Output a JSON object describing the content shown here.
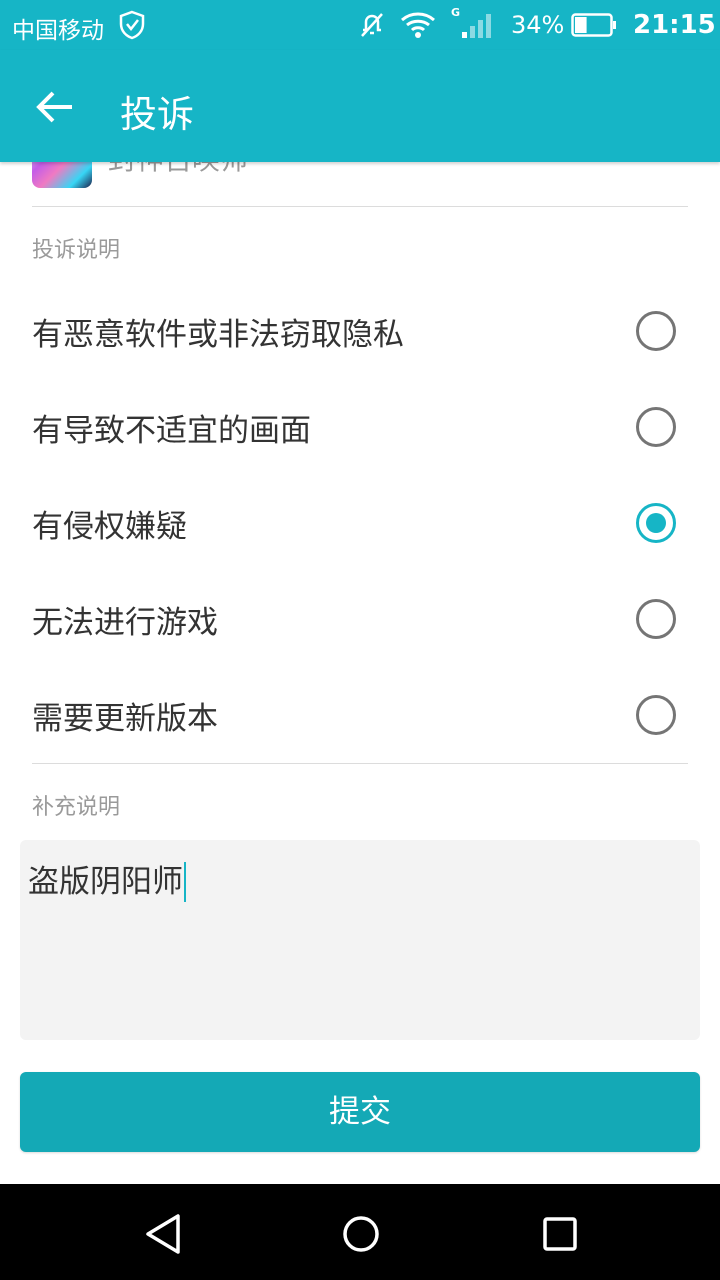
{
  "status_bar": {
    "carrier": "中国移动",
    "network": "G",
    "battery_percent": "34%",
    "battery_level": 0.34,
    "time": "21:15"
  },
  "app_bar": {
    "title": "投诉"
  },
  "game": {
    "name": "封神召唤师"
  },
  "complaint_section": {
    "label": "投诉说明",
    "options": [
      {
        "label": "有恶意软件或非法窃取隐私",
        "selected": false
      },
      {
        "label": "有导致不适宜的画面",
        "selected": false
      },
      {
        "label": "有侵权嫌疑",
        "selected": true
      },
      {
        "label": "无法进行游戏",
        "selected": false
      },
      {
        "label": "需要更新版本",
        "selected": false
      }
    ]
  },
  "supplement_section": {
    "label": "补充说明",
    "value": "盗版阴阳师"
  },
  "submit_label": "提交",
  "colors": {
    "accent": "#16b5c6",
    "button": "#14a9b6"
  },
  "icons": [
    "shield-check-icon",
    "mute-icon",
    "wifi-icon",
    "signal-icon",
    "battery-icon",
    "back-arrow-icon",
    "nav-back-icon",
    "nav-home-icon",
    "nav-recents-icon"
  ]
}
